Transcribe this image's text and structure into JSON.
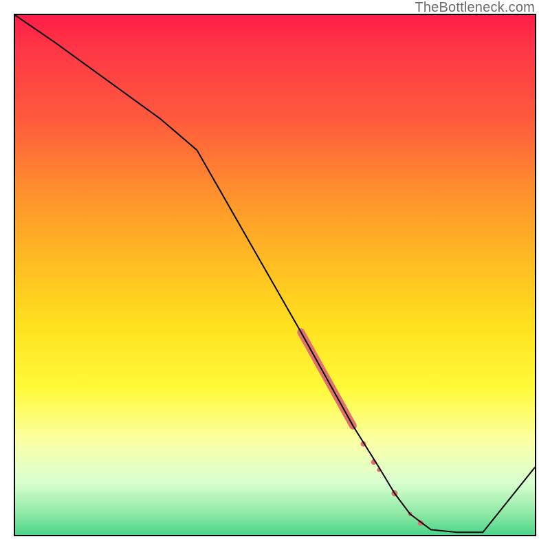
{
  "watermark": "TheBottleneck.com",
  "chart_data": {
    "type": "line",
    "title": "",
    "xlabel": "",
    "ylabel": "",
    "xlim": [
      0,
      100
    ],
    "ylim": [
      0,
      100
    ],
    "grid": false,
    "legend": false,
    "series": [
      {
        "name": "curve",
        "x": [
          0,
          8,
          28,
          35,
          55,
          60,
          65,
          70,
          73,
          76,
          80,
          85,
          90,
          100
        ],
        "y": [
          100,
          94.5,
          80,
          74,
          39,
          30,
          21,
          13,
          8,
          4,
          1,
          0.5,
          0.5,
          13
        ],
        "stroke": "#000000",
        "stroke_width": 2
      }
    ],
    "highlight_segment": {
      "name": "highlight",
      "color": "#e0716f",
      "thick_width": 11,
      "thin_width": 6,
      "points_thick": {
        "x": [
          55,
          65
        ],
        "y": [
          39,
          21
        ]
      },
      "points_after": [
        {
          "x": 67,
          "y": 17.5,
          "w": 8
        },
        {
          "x": 69,
          "y": 14,
          "w": 8
        },
        {
          "x": 70,
          "y": 12.5,
          "w": 6
        },
        {
          "x": 73,
          "y": 8,
          "w": 9
        },
        {
          "x": 76,
          "y": 4,
          "w": 6
        },
        {
          "x": 78,
          "y": 2.3,
          "w": 8
        }
      ]
    }
  }
}
